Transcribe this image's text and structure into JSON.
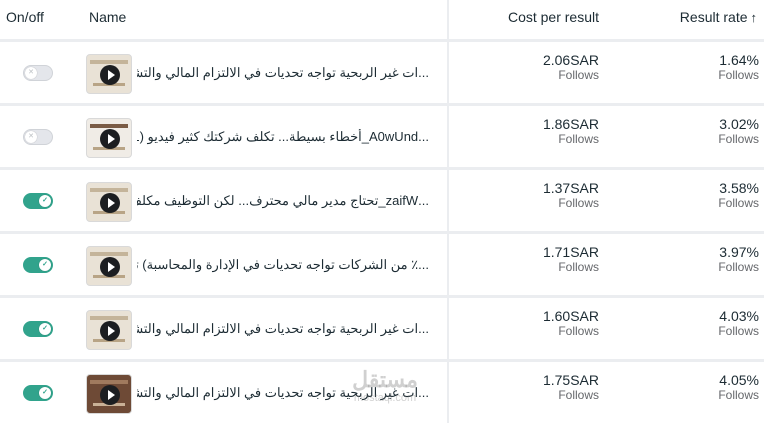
{
  "header": {
    "onoff": "On/off",
    "name": "Name",
    "cost": "Cost per result",
    "rate": "Result rate",
    "sort_arrow": "↑"
  },
  "rows": [
    {
      "on": false,
      "name": "...ات غير الربحية تواجه تحديات في الالتزام المالي والتشغيلي",
      "cost": "2.06SAR",
      "cost_sub": "Follows",
      "rate": "1.64%",
      "rate_sub": "Follows"
    },
    {
      "on": false,
      "name": "...A0wUnd_أخطاء بسيطة... تكلف شركتك كثير فيديو (1)",
      "cost": "1.86SAR",
      "cost_sub": "Follows",
      "rate": "3.02%",
      "rate_sub": "Follows"
    },
    {
      "on": true,
      "name": "...zaifW_تحتاج مدير مالي محترف... لكن التوظيف مكلف؟",
      "cost": "1.37SAR",
      "cost_sub": "Follows",
      "rate": "3.58%",
      "rate_sub": "Follows"
    },
    {
      "on": true,
      "name": "...٪ من الشركات تواجه تحديات في الإدارة والمحاسبة) تيكتوك",
      "cost": "1.71SAR",
      "cost_sub": "Follows",
      "rate": "3.97%",
      "rate_sub": "Follows"
    },
    {
      "on": true,
      "name": "...ات غير الربحية تواجه تحديات في الالتزام المالي والتشغيلي",
      "cost": "1.60SAR",
      "cost_sub": "Follows",
      "rate": "4.03%",
      "rate_sub": "Follows"
    },
    {
      "on": true,
      "name": "...ات غير الربحية تواجه تحديات في الالتزام المالي والتشغيلي",
      "cost": "1.75SAR",
      "cost_sub": "Follows",
      "rate": "4.05%",
      "rate_sub": "Follows"
    }
  ],
  "watermark": {
    "line1": "مستقل",
    "line2": "mostaql.com"
  },
  "colors": {
    "toggle_on": "#31a38c",
    "toggle_off": "#e4e6eb",
    "divider": "#ebedf0"
  }
}
